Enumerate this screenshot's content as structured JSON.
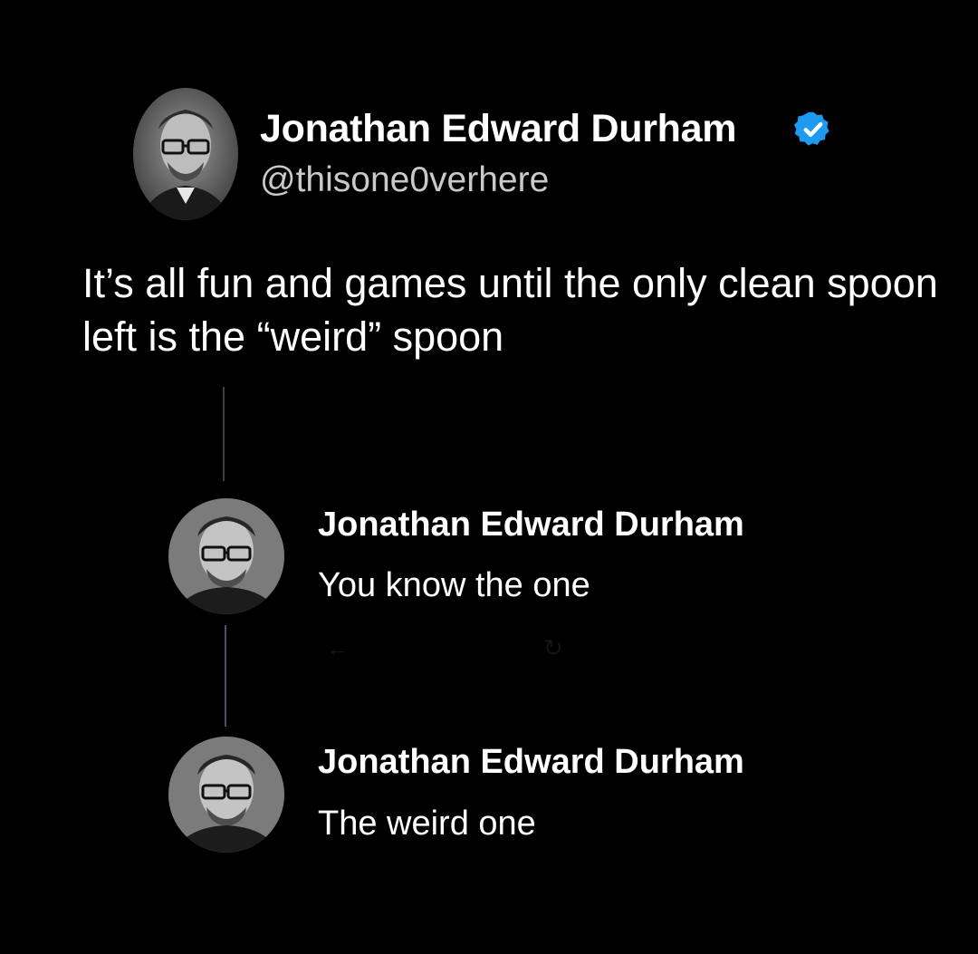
{
  "tweet": {
    "author_name": "Jonathan Edward Durham",
    "handle": "@thisone0verhere",
    "verified": true,
    "text": "It’s all fun and games until the only clean spoon left is the “weird” spoon"
  },
  "replies": [
    {
      "author_name": "Jonathan Edward Durham",
      "text": "You know the one"
    },
    {
      "author_name": "Jonathan Edward Durham",
      "text": "The weird one"
    }
  ],
  "colors": {
    "background": "#000000",
    "text": "#ffffff",
    "handle": "#c9c9c9",
    "verified": "#1d9bf0",
    "thread_line": "#3b3f44"
  },
  "icons": {
    "verified_badge": "verified-badge-icon",
    "reply": "reply-icon",
    "retweet": "retweet-icon"
  }
}
